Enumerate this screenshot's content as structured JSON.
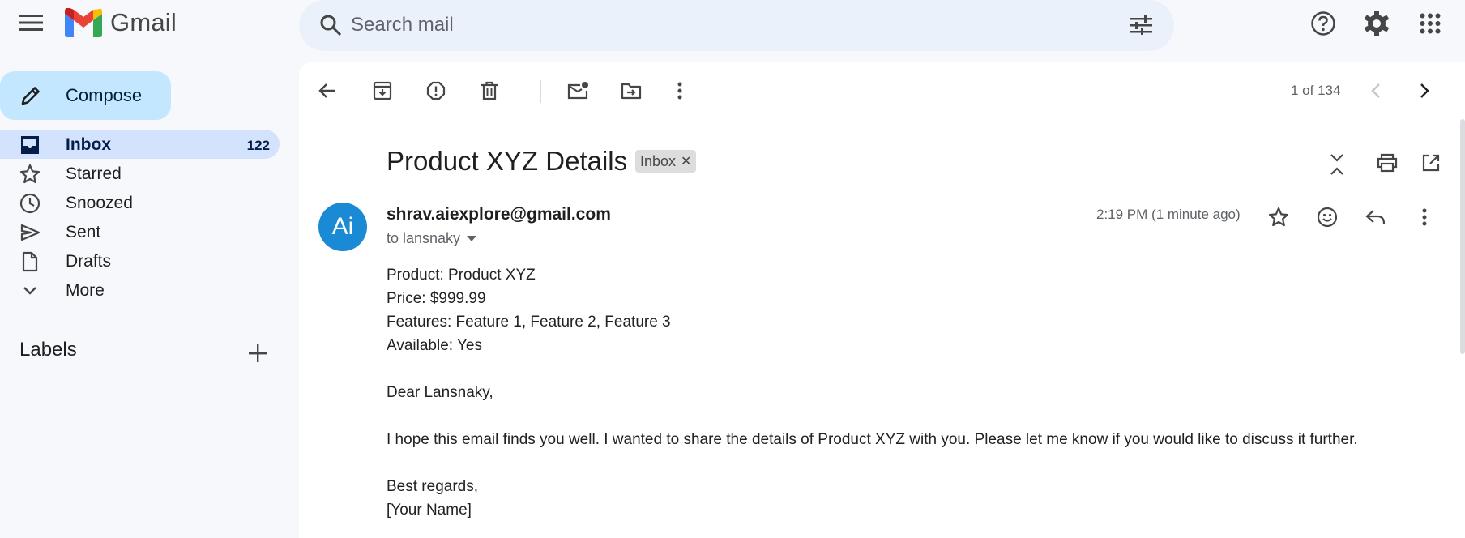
{
  "app": {
    "name": "Gmail"
  },
  "search": {
    "placeholder": "Search mail"
  },
  "sidebar": {
    "compose_label": "Compose",
    "items": [
      {
        "label": "Inbox",
        "count": "122",
        "icon": "inbox-icon"
      },
      {
        "label": "Starred",
        "count": "",
        "icon": "star-icon"
      },
      {
        "label": "Snoozed",
        "count": "",
        "icon": "clock-icon"
      },
      {
        "label": "Sent",
        "count": "",
        "icon": "send-icon"
      },
      {
        "label": "Drafts",
        "count": "",
        "icon": "draft-icon"
      },
      {
        "label": "More",
        "count": "",
        "icon": "chevron-down-icon"
      }
    ],
    "labels_heading": "Labels"
  },
  "toolbar": {
    "pager": "1 of 134"
  },
  "email": {
    "subject": "Product XYZ Details",
    "label_chip": "Inbox",
    "avatar_initials": "Ai",
    "sender": "shrav.aiexplore@gmail.com",
    "to": "to lansnaky",
    "time": "2:19 PM (1 minute ago)",
    "body": {
      "line1": "Product: Product XYZ",
      "line2": "Price: $999.99",
      "line3": "Features: Feature 1, Feature 2, Feature 3",
      "line4": "Available: Yes",
      "greeting": "Dear Lansnaky,",
      "paragraph": "I hope this email finds you well. I wanted to share the details of Product XYZ with you. Please let me know if you would like to discuss it further.",
      "closing": "Best regards,",
      "signature": "[Your Name]"
    }
  },
  "colors": {
    "background": "#f6f8fc",
    "compose": "#c2e7ff",
    "active_nav": "#d3e3fd",
    "search": "#eaf1fb",
    "avatar": "#1a8ad4"
  }
}
